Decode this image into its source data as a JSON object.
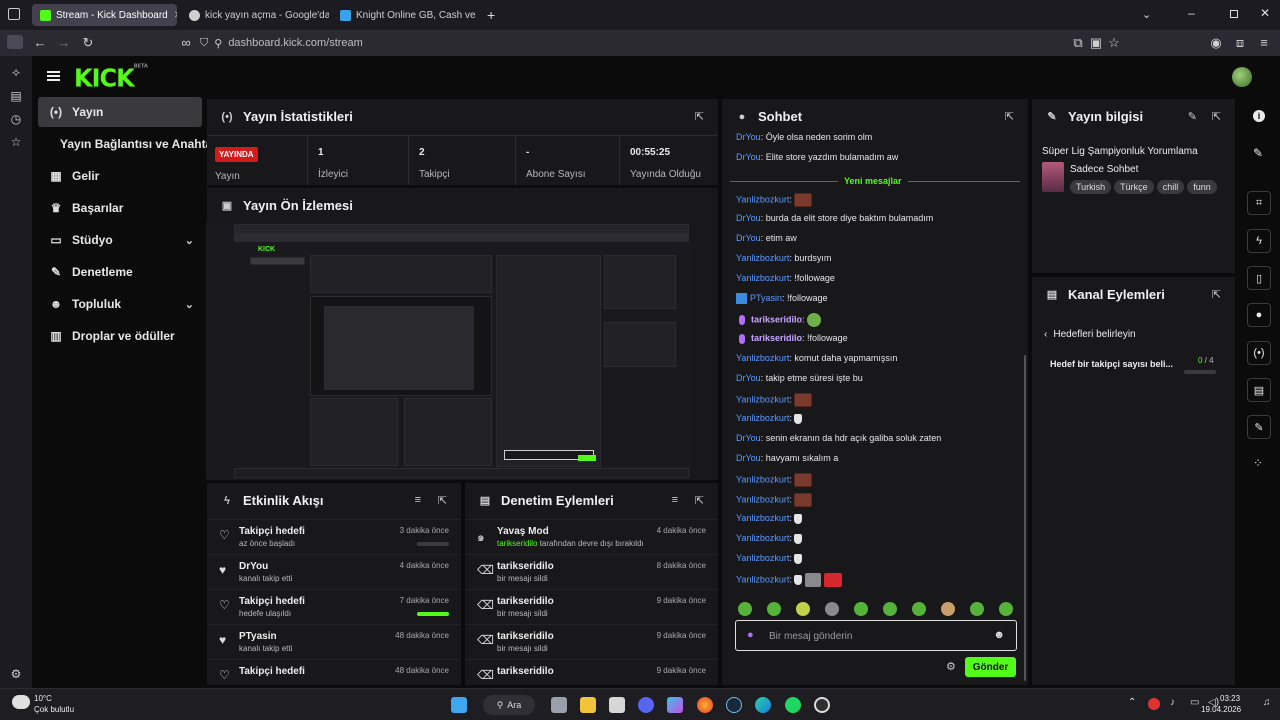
{
  "browser": {
    "tabs": [
      {
        "title": "Stream - Kick Dashboard",
        "active": true,
        "color": "#53fc18"
      },
      {
        "title": "kick yayın açma - Google'da Ara",
        "active": false,
        "color": "#cfcfcf"
      },
      {
        "title": "Knight Online GB, Cash ve İtem",
        "active": false,
        "color": "#37a3e8"
      }
    ],
    "url": "dashboard.kick.com/stream"
  },
  "kick": {
    "logo": "KICK",
    "logo_beta": "BETA"
  },
  "menu": [
    {
      "label": "Yayın",
      "icon": "broadcast-icon",
      "glyph": "(•)"
    },
    {
      "label": "Yayın Bağlantısı ve Anahtarı",
      "icon": "",
      "glyph": ""
    },
    {
      "label": "Gelir",
      "icon": "revenue-icon",
      "glyph": "▦"
    },
    {
      "label": "Başarılar",
      "icon": "trophy-icon",
      "glyph": "♛"
    },
    {
      "label": "Stüdyo",
      "icon": "studio-icon",
      "glyph": "▭",
      "chevron": "⌄"
    },
    {
      "label": "Denetleme",
      "icon": "wrench-icon",
      "glyph": "✎"
    },
    {
      "label": "Topluluk",
      "icon": "community-icon",
      "glyph": "☻",
      "chevron": "⌄"
    },
    {
      "label": "Droplar ve ödüller",
      "icon": "drops-icon",
      "glyph": "▥"
    }
  ],
  "stats": {
    "title": "Yayın İstatistikleri",
    "live_badge": "YAYINDA",
    "items": [
      {
        "value": "",
        "label": "Yayın"
      },
      {
        "value": "1",
        "label": "İzleyici"
      },
      {
        "value": "2",
        "label": "Takipçi"
      },
      {
        "value": "-",
        "label": "Abone Sayısı"
      },
      {
        "value": "00:55:25",
        "label": "Yayında Olduğu"
      }
    ]
  },
  "preview": {
    "title": "Yayın Ön İzlemesi"
  },
  "events": {
    "title": "Etkinlik Akışı",
    "rows": [
      {
        "title": "Takipçi hedefi",
        "sub": "az önce başladı",
        "time": "3 dakika önce",
        "icon": "heart-outline-icon",
        "progress": 0
      },
      {
        "title": "DrYou",
        "sub": "kanalı takip etti",
        "time": "4 dakika önce",
        "icon": "heart-icon"
      },
      {
        "title": "Takipçi hedefi",
        "sub": "hedefe ulaşıldı",
        "time": "7 dakika önce",
        "icon": "heart-outline-icon",
        "progress": 1
      },
      {
        "title": "PTyasin",
        "sub": "kanalı takip etti",
        "time": "48 dakika önce",
        "icon": "heart-icon"
      },
      {
        "title": "Takipçi hedefi",
        "sub": "",
        "time": "48 dakika önce",
        "icon": "heart-outline-icon"
      }
    ]
  },
  "moderation": {
    "title": "Denetim Eylemleri",
    "rows": [
      {
        "title": "Yavaş Mod",
        "user": "tarikseridilo",
        "sub": " tarafından devre dışı bırakıldı",
        "time": "4 dakika önce",
        "icon": "snail-icon"
      },
      {
        "title": "tarikseridilo",
        "user": "",
        "sub": "bir mesajı sildi",
        "time": "8 dakika önce",
        "icon": "trash-icon"
      },
      {
        "title": "tarikseridilo",
        "user": "",
        "sub": "bir mesajı sildi",
        "time": "9 dakika önce",
        "icon": "trash-icon"
      },
      {
        "title": "tarikseridilo",
        "user": "",
        "sub": "bir mesajı sildi",
        "time": "9 dakika önce",
        "icon": "trash-icon"
      },
      {
        "title": "tarikseridilo",
        "user": "",
        "sub": "",
        "time": "9 dakika önce",
        "icon": "trash-icon"
      }
    ]
  },
  "chat": {
    "title": "Sohbet",
    "new_messages": "Yeni mesajlar",
    "messages": [
      {
        "user": "DrYou",
        "color": "blue",
        "text": "Öyle olsa neden sorim olm",
        "emotes": []
      },
      {
        "user": "DrYou",
        "color": "blue",
        "text": "Elite store yazdım bulamadım aw",
        "emotes": []
      },
      {
        "user": "Yanlizbozkurt",
        "color": "blue",
        "text": "",
        "emotes": [
          "face"
        ]
      },
      {
        "user": "DrYou",
        "color": "blue",
        "text": "burda da elit store diye baktım bulamadım",
        "emotes": []
      },
      {
        "user": "DrYou",
        "color": "blue",
        "text": "etim aw",
        "emotes": []
      },
      {
        "user": "Yanlizbozkurt",
        "color": "blue",
        "text": "burdsyım",
        "emotes": []
      },
      {
        "user": "Yanlizbozkurt",
        "color": "blue",
        "text": "!followage",
        "emotes": []
      },
      {
        "user": "PTyasin",
        "color": "blue",
        "text": "!followage",
        "emotes": [],
        "badge": true
      },
      {
        "user": "tarikseridilo",
        "color": "purple",
        "text": "",
        "emotes": [
          "green"
        ],
        "mic": true
      },
      {
        "user": "tarikseridilo",
        "color": "purple",
        "text": "!followage",
        "emotes": [],
        "mic": true
      },
      {
        "user": "Yanlizbozkurt",
        "color": "blue",
        "text": "komut daha yapmamışsın",
        "emotes": []
      },
      {
        "user": "DrYou",
        "color": "blue",
        "text": "takip etme süresi işte bu",
        "emotes": []
      },
      {
        "user": "Yanlizbozkurt",
        "color": "blue",
        "text": "",
        "emotes": [
          "face"
        ]
      },
      {
        "user": "Yanlizbozkurt",
        "color": "blue",
        "text": "",
        "emotes": [
          "small"
        ]
      },
      {
        "user": "DrYou",
        "color": "blue",
        "text": "senin ekranın da hdr açık galiba soluk zaten",
        "emotes": []
      },
      {
        "user": "DrYou",
        "color": "blue",
        "text": "havyamı sıkalım a",
        "emotes": []
      },
      {
        "user": "Yanlizbozkurt",
        "color": "blue",
        "text": "",
        "emotes": [
          "face"
        ]
      },
      {
        "user": "Yanlizbozkurt",
        "color": "blue",
        "text": "",
        "emotes": [
          "face"
        ]
      },
      {
        "user": "Yanlizbozkurt",
        "color": "blue",
        "text": "",
        "emotes": [
          "small"
        ]
      },
      {
        "user": "Yanlizbozkurt",
        "color": "blue",
        "text": "",
        "emotes": [
          "small"
        ]
      },
      {
        "user": "Yanlizbozkurt",
        "color": "blue",
        "text": "",
        "emotes": [
          "small"
        ]
      },
      {
        "user": "Yanlizbozkurt",
        "color": "blue",
        "text": "",
        "emotes": [
          "small",
          "gray",
          "flag"
        ]
      }
    ],
    "input_placeholder": "Bir mesaj gönderin",
    "send_label": "Gönder"
  },
  "stream_info": {
    "title": "Yayın bilgisi",
    "stream_title": "Süper Lig Şampiyonluk Yorumlama",
    "category": "Sadece Sohbet",
    "tags": [
      "Turkish",
      "Türkçe",
      "chill",
      "funn"
    ]
  },
  "channel_actions": {
    "title": "Kanal Eylemleri",
    "back_label": "Hedefleri belirleyin",
    "goal_label": "Hedef bir takipçi sayısı beli...",
    "goal_current": "0",
    "goal_sep": " / ",
    "goal_total": "4",
    "goal_progress": 0
  },
  "taskbar": {
    "weather_temp": "10°C",
    "weather_desc": "Çok bulutlu",
    "search_label": "Ara",
    "time": "03:23",
    "date": "19.04.2026"
  },
  "colors": {
    "accent": "#53fc18",
    "live_red": "#d21c1c",
    "user_blue": "#5b9bff",
    "user_purple": "#c7a4ff"
  }
}
